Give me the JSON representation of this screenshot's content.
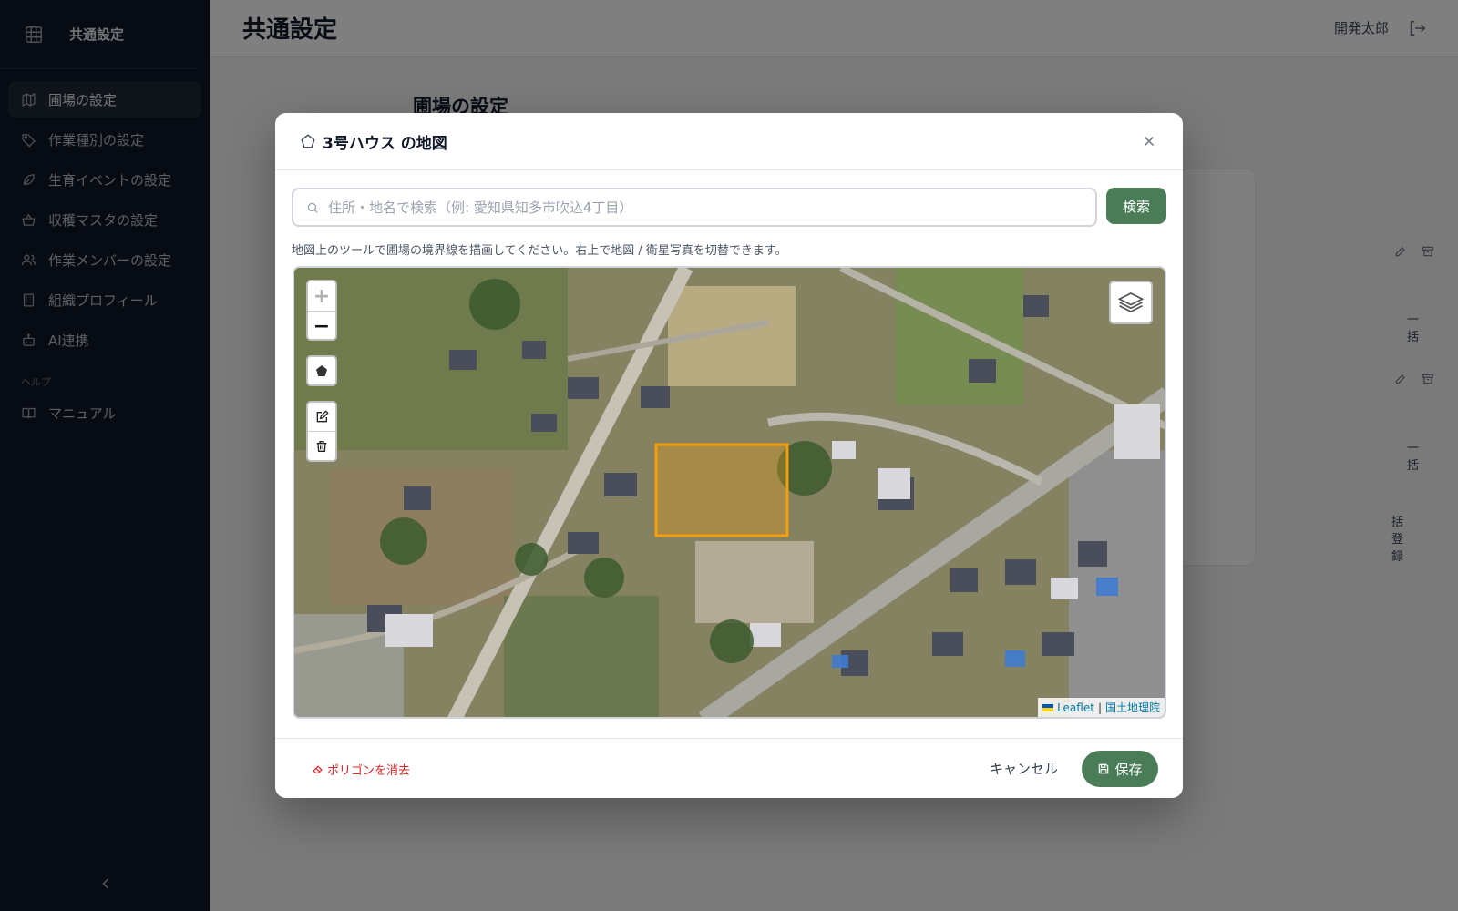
{
  "sidebar": {
    "title": "共通設定",
    "items": [
      {
        "label": "圃場の設定",
        "icon": "map-icon",
        "active": true
      },
      {
        "label": "作業種別の設定",
        "icon": "tag-icon"
      },
      {
        "label": "生育イベントの設定",
        "icon": "leaf-icon"
      },
      {
        "label": "収穫マスタの設定",
        "icon": "basket-icon"
      },
      {
        "label": "作業メンバーの設定",
        "icon": "users-icon"
      },
      {
        "label": "組織プロフィール",
        "icon": "building-icon"
      },
      {
        "label": "AI連携",
        "icon": "bot-icon"
      }
    ],
    "help_section": "ヘルプ",
    "help_items": [
      {
        "label": "マニュアル",
        "icon": "book-icon"
      }
    ]
  },
  "header": {
    "title": "共通設定",
    "user_name": "開発太郎"
  },
  "content": {
    "section_title": "圃場の設定",
    "bg_texts": [
      "一括",
      "一括",
      "括登録"
    ]
  },
  "modal": {
    "title": "3号ハウス の地図",
    "search": {
      "placeholder": "住所・地名で検索（例: 愛知県知多市吹込4丁目）",
      "value": "",
      "button_label": "検索"
    },
    "hint": "地図上のツールで圃場の境界線を描画してください。右上で地図 / 衛星写真を切替できます。",
    "map": {
      "zoom_in": "+",
      "zoom_out": "−",
      "attribution": {
        "leaflet": "Leaflet",
        "separator": "|",
        "provider": "国土地理院"
      },
      "base_layer": "satellite",
      "polygon_color": "#f59e0b"
    },
    "footer": {
      "clear_label": "ポリゴンを消去",
      "cancel_label": "キャンセル",
      "save_label": "保存"
    }
  },
  "colors": {
    "sidebar_bg": "#0f1626",
    "accent": "#4a7d57",
    "danger": "#dc2626"
  }
}
